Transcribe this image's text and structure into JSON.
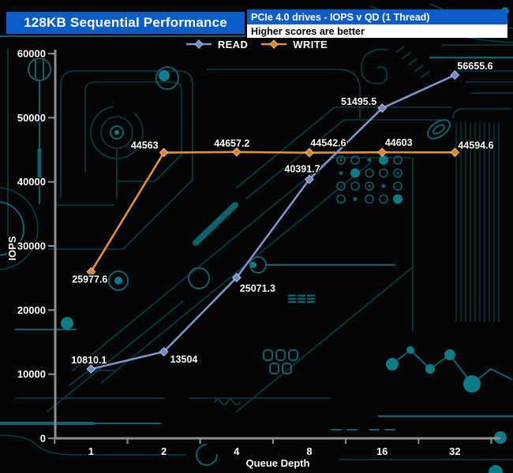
{
  "header": {
    "title": "128KB Sequential Performance",
    "subtitle": "PCIe 4.0 drives - IOPS v QD (1 Thread)",
    "note": "Higher scores are better",
    "banner_color": "#0b5cc4"
  },
  "legend": {
    "items": [
      {
        "label": "READ",
        "color": "#8094ca",
        "marker_color": "#7289c6"
      },
      {
        "label": "WRITE",
        "color": "#e2913c",
        "marker_color": "#d8862f"
      }
    ]
  },
  "colors": {
    "axis": "#8f8f8f",
    "text": "#ffffff",
    "circuit_dim": "#093f45",
    "circuit_mid": "#0d626b",
    "circuit_bright": "#0e7c88"
  },
  "chart_data": {
    "type": "line",
    "title": "128KB Sequential Performance",
    "subtitle": "PCIe 4.0 drives - IOPS v QD (1 Thread)",
    "note": "Higher scores are better",
    "categories": [
      "1",
      "2",
      "4",
      "8",
      "16",
      "32"
    ],
    "xlabel": "Queue Depth",
    "ylabel": "IOPS",
    "ylim": [
      0,
      60000
    ],
    "ytick_step": 10000,
    "ytick_labels": [
      "0",
      "10000",
      "20000",
      "30000",
      "40000",
      "50000",
      "60000"
    ],
    "grid": false,
    "legend_position": "top-center",
    "series": [
      {
        "name": "READ",
        "color": "#8094ca",
        "values": [
          10810.1,
          13504,
          25071.3,
          40391.7,
          51495.5,
          56655.6
        ]
      },
      {
        "name": "WRITE",
        "color": "#e2913c",
        "values": [
          25977.6,
          44563,
          44657.2,
          44542.6,
          44603,
          44594.6
        ]
      }
    ]
  }
}
